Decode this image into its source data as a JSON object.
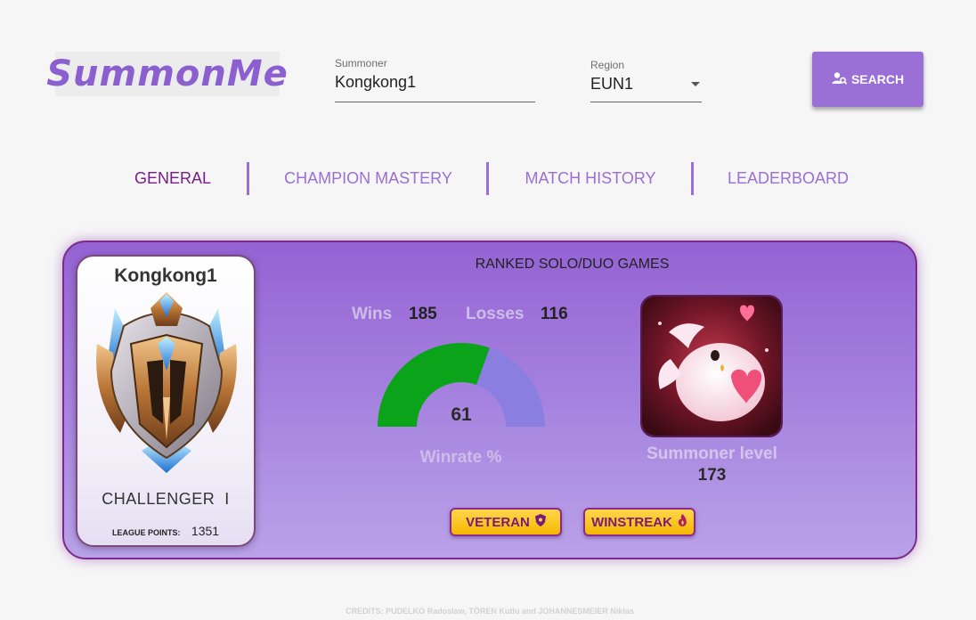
{
  "app": {
    "logo": "SummonMe"
  },
  "search": {
    "summoner_label": "Summoner",
    "summoner_value": "Kongkong1",
    "region_label": "Region",
    "region_value": "EUN1",
    "button_label": "SEARCH"
  },
  "tabs": [
    {
      "label": "GENERAL",
      "active": true
    },
    {
      "label": "CHAMPION MASTERY",
      "active": false
    },
    {
      "label": "MATCH HISTORY",
      "active": false
    },
    {
      "label": "LEADERBOARD",
      "active": false
    }
  ],
  "profile": {
    "name": "Kongkong1",
    "rank": "CHALLENGER",
    "division": "I",
    "league_points_label": "LEAGUE POINTS:",
    "league_points": "1351",
    "emblem_icon": "challenger-emblem-icon"
  },
  "ranked": {
    "title": "RANKED SOLO/DUO GAMES",
    "wins_label": "Wins",
    "wins": "185",
    "losses_label": "Losses",
    "losses": "116",
    "winrate": "61",
    "winrate_fraction": 0.61,
    "winrate_label": "Winrate %"
  },
  "summoner": {
    "icon": "pink-poro-summoner-icon",
    "level_label": "Summoner level",
    "level": "173"
  },
  "badges": [
    {
      "label": "VETERAN",
      "icon": "shield-icon"
    },
    {
      "label": "WINSTREAK",
      "icon": "flame-icon"
    }
  ],
  "colors": {
    "accent": "#9a6fd6",
    "active_tab": "#7a1c8a",
    "gauge_fill": "#0aa31a",
    "gauge_track": "#8a7fe0",
    "badge": "#ffc81e"
  },
  "footer": {
    "credits": "CREDITS: PUDELKO Radoslaw, TÖREN Kutlu and JOHANNESMEIER Niklas"
  }
}
